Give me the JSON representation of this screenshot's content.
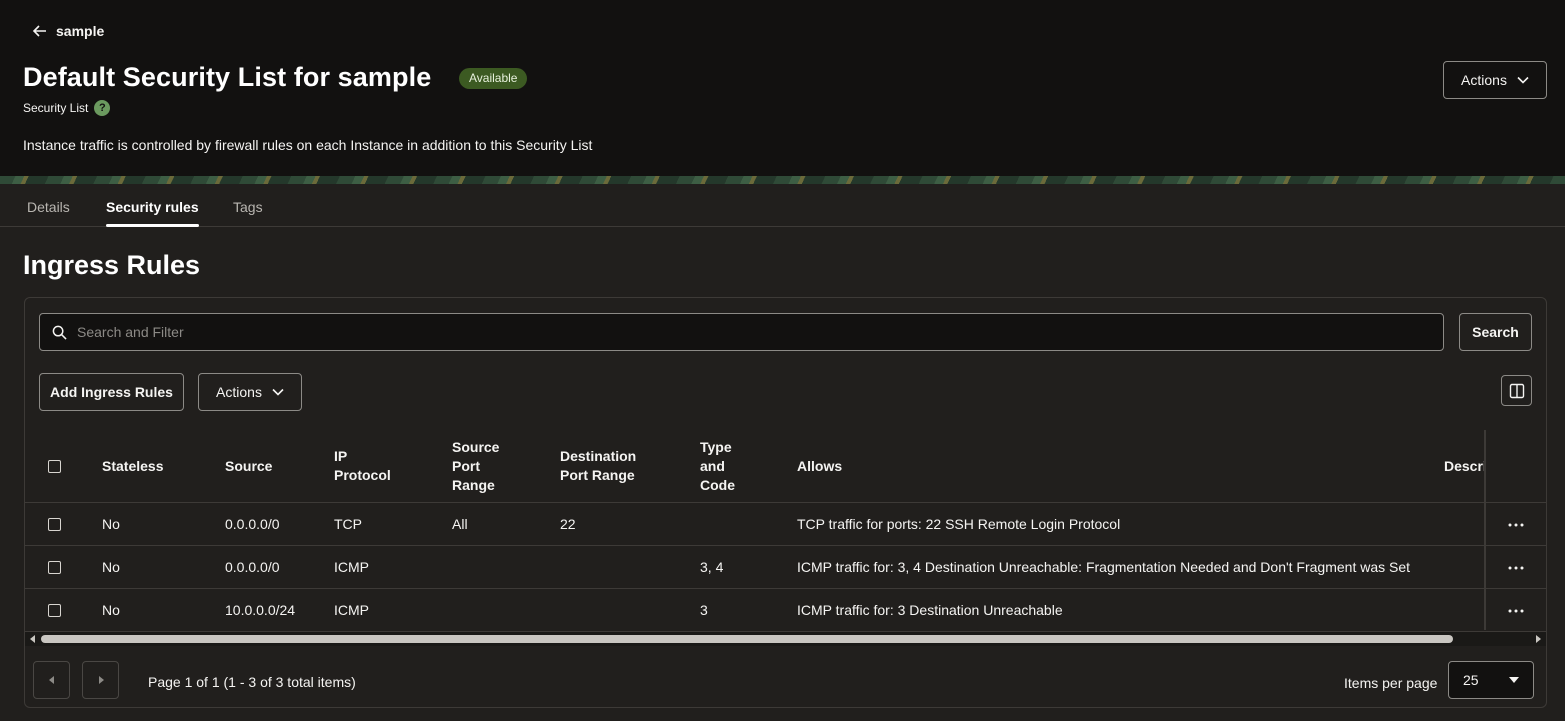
{
  "header": {
    "back_label": "sample",
    "title": "Default Security List for sample",
    "status": "Available",
    "subtitle": "Security List",
    "help_glyph": "?",
    "description": "Instance traffic is controlled by firewall rules on each Instance in addition to this Security List",
    "actions_label": "Actions"
  },
  "tabs": [
    {
      "label": "Details"
    },
    {
      "label": "Security rules",
      "active": true
    },
    {
      "label": "Tags"
    }
  ],
  "section": {
    "title": "Ingress Rules"
  },
  "toolbar": {
    "search_placeholder": "Search and Filter",
    "search_label": "Search",
    "add_label": "Add Ingress Rules",
    "actions_label": "Actions"
  },
  "table": {
    "headers": {
      "stateless": "Stateless",
      "source": "Source",
      "ip_protocol_1": "IP",
      "ip_protocol_2": "Protocol",
      "source_port_1": "Source",
      "source_port_2": "Port",
      "source_port_3": "Range",
      "dest_port_1": "Destination",
      "dest_port_2": "Port Range",
      "type_code_1": "Type",
      "type_code_2": "and",
      "type_code_3": "Code",
      "allows": "Allows",
      "description": "Descri"
    },
    "rows": [
      {
        "stateless": "No",
        "source": "0.0.0.0/0",
        "protocol": "TCP",
        "source_port": "All",
        "dest_port": "22",
        "type_code": "",
        "allows": "TCP traffic for ports: 22 SSH Remote Login Protocol"
      },
      {
        "stateless": "No",
        "source": "0.0.0.0/0",
        "protocol": "ICMP",
        "source_port": "",
        "dest_port": "",
        "type_code": "3, 4",
        "allows": "ICMP traffic for: 3, 4 Destination Unreachable: Fragmentation Needed and Don't Fragment was Set"
      },
      {
        "stateless": "No",
        "source": "10.0.0.0/24",
        "protocol": "ICMP",
        "source_port": "",
        "dest_port": "",
        "type_code": "3",
        "allows": "ICMP traffic for: 3 Destination Unreachable"
      }
    ]
  },
  "pagination": {
    "info": "Page 1 of 1 (1 - 3 of 3 total items)",
    "items_per_page_label": "Items per page",
    "items_per_page": "25"
  },
  "icons": {
    "back": "arrow-left-icon",
    "help": "help-circle-icon",
    "search": "search-icon",
    "columns": "columns-icon",
    "more": "more-horizontal-icon"
  },
  "colors": {
    "status_badge_bg": "#3c5a22",
    "help_icon": "#6b9a5f",
    "header_bg": "#121110",
    "page_bg": "#211f1d"
  }
}
